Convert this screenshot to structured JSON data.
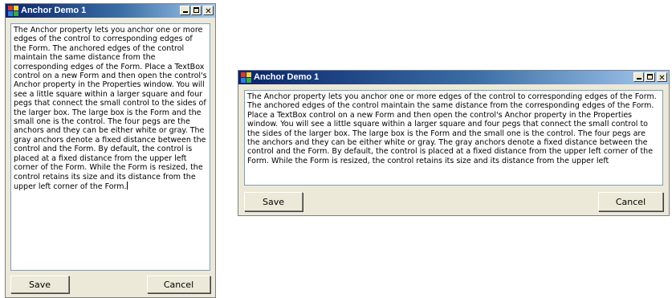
{
  "windows": [
    {
      "title": "Anchor Demo 1",
      "text": "The Anchor property lets you anchor one or more edges of the control to corresponding edges of the Form. The anchored edges of the control maintain the same distance from the corresponding edges of the Form. Place a TextBox control on a new Form and then open the control's Anchor property in the Properties window. You will see a little square within a larger square and four pegs that connect the small control to the sides of the larger box. The large box is the Form and the small one is the control. The four pegs are the anchors and they can be either white or gray. The gray anchors denote a fixed distance between the control and the Form. By default, the control is placed at a fixed distance from the upper left corner of the Form. While the Form is resized, the control retains its size and its distance from the upper left corner of the Form.",
      "save_label": "Save",
      "cancel_label": "Cancel"
    },
    {
      "title": "Anchor Demo 1",
      "text": "The Anchor property lets you anchor one or more edges of the control to corresponding edges of the Form. The anchored edges of the control maintain the same distance from the corresponding edges of the Form. Place a TextBox control on a new Form and then open the control's Anchor property in the Properties window. You will see a little square within a larger square and four pegs that connect the small control to the sides of the larger box. The large box is the Form and the small one is the control. The four pegs are the anchors and they can be either white or gray. The gray anchors denote a fixed distance between the control and the Form. By default, the control is placed at a fixed distance from the upper left corner of the Form. While the Form is resized, the control retains its size and its distance from the upper left",
      "save_label": "Save",
      "cancel_label": "Cancel"
    }
  ],
  "icons": [
    "app-icon",
    "minimize-icon",
    "maximize-icon",
    "close-icon"
  ],
  "colors": {
    "titlebar_start": "#0a246a",
    "titlebar_end": "#a6caf0",
    "window_bg": "#ece9d8"
  }
}
